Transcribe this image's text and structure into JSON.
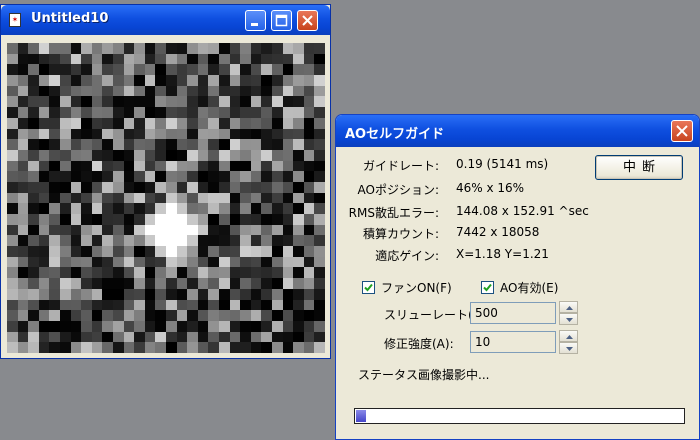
{
  "image_window": {
    "title": "Untitled10",
    "icons": [
      "app-document-icon",
      "minimize-icon",
      "maximize-icon",
      "close-icon"
    ]
  },
  "dialog": {
    "title": "AOセルフガイド",
    "stop_button": "中断",
    "rows": [
      {
        "label": "ガイドレート:",
        "value": "0.19 (5141 ms)"
      },
      {
        "label": "AOポジション:",
        "value": "46% x  16%"
      },
      {
        "label": "RMS散乱エラー:",
        "value": "144.08 x 152.91 ^sec"
      },
      {
        "label": "積算カウント:",
        "value": "7442 x 18058"
      },
      {
        "label": "適応ゲイン:",
        "value": "X=1.18    Y=1.21"
      }
    ],
    "checkboxes": [
      {
        "label": "ファンON(F)",
        "checked": true
      },
      {
        "label": "AO有効(E)",
        "checked": true
      }
    ],
    "slew_rate": {
      "label": "スリューレート(S):",
      "value": "500"
    },
    "correction": {
      "label": "修正強度(A):",
      "value": "10"
    },
    "status": {
      "label": "ステータス:",
      "value": "画像撮影中..."
    },
    "progress_fraction": 0.03,
    "accent_color": "#0845d4"
  }
}
